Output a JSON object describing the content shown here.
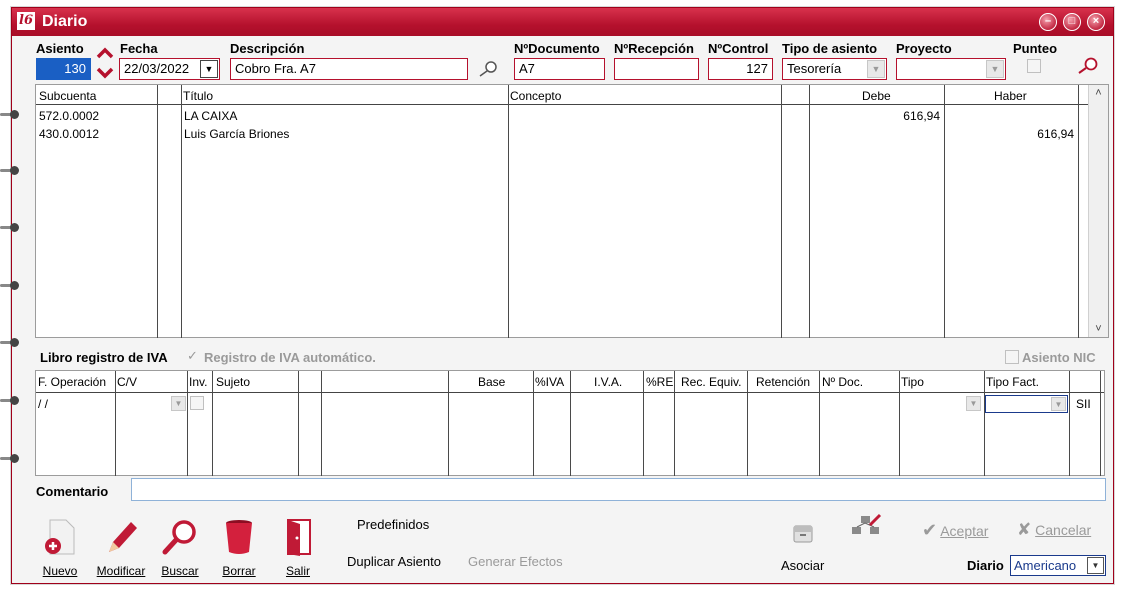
{
  "window": {
    "title": "Diario",
    "accent": "#b5112d"
  },
  "header": {
    "asiento_label": "Asiento",
    "asiento_value": "130",
    "fecha_label": "Fecha",
    "fecha_value": "22/03/2022",
    "descripcion_label": "Descripción",
    "descripcion_value": "Cobro Fra. A7",
    "ndocumento_label": "NºDocumento",
    "ndocumento_value": "A7",
    "nrecepcion_label": "NºRecepción",
    "nrecepcion_value": "",
    "ncontrol_label": "NºControl",
    "ncontrol_value": "127",
    "tipo_asiento_label": "Tipo de asiento",
    "tipo_asiento_value": "Tesorería",
    "proyecto_label": "Proyecto",
    "proyecto_value": "",
    "punteo_label": "Punteo"
  },
  "entries": {
    "columns": [
      "Subcuenta",
      "Título",
      "Concepto",
      "",
      "Debe",
      "Haber"
    ],
    "rows": [
      {
        "subcuenta": "572.0.0002",
        "titulo": "LA CAIXA",
        "concepto": "",
        "debe": "616,94",
        "haber": ""
      },
      {
        "subcuenta": "430.0.0012",
        "titulo": "Luis García Briones",
        "concepto": "",
        "debe": "",
        "haber": "616,94"
      }
    ]
  },
  "iva": {
    "section_label": "Libro registro de IVA",
    "auto_label": "Registro de IVA automático.",
    "nic_label": "Asiento NIC",
    "columns": [
      "F. Operación",
      "C/V",
      "Inv.",
      "Sujeto",
      "",
      "",
      "Base",
      "%IVA",
      "I.V.A.",
      "%RE",
      "Rec. Equiv.",
      "Retención",
      "Nº Doc.",
      "Tipo",
      "Tipo Fact.",
      ""
    ],
    "row": {
      "fecha": " / /",
      "sii": "SII"
    }
  },
  "comentario": {
    "label": "Comentario",
    "value": ""
  },
  "toolbar": {
    "nuevo": "Nuevo",
    "modificar": "Modificar",
    "buscar": "Buscar",
    "borrar": "Borrar",
    "salir": "Salir",
    "predefinidos": "Predefinidos",
    "duplicar": "Duplicar Asiento",
    "generar": "Generar Efectos",
    "asociar": "Asociar",
    "aceptar": "Aceptar",
    "cancelar": "Cancelar",
    "diario_label": "Diario",
    "diario_value": "Americano"
  }
}
